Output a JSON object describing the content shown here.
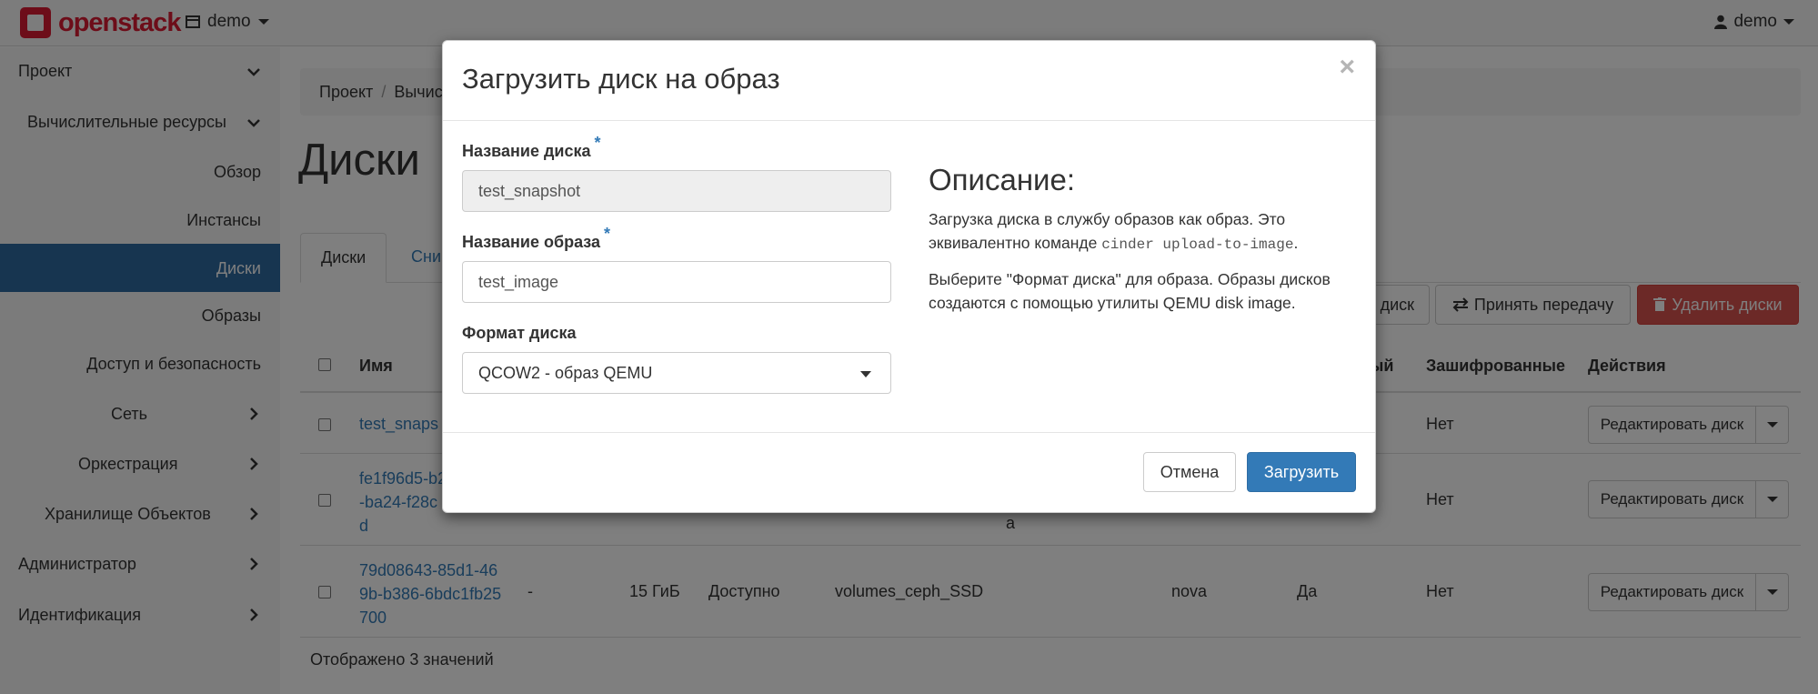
{
  "navbar": {
    "logo_text": "openstack",
    "project_label": "demo",
    "user_label": "demo"
  },
  "sidebar": {
    "items": [
      {
        "label": "Проект"
      },
      {
        "label": "Вычислительные ресурсы"
      },
      {
        "label": "Обзор"
      },
      {
        "label": "Инстансы"
      },
      {
        "label": "Диски"
      },
      {
        "label": "Образы"
      },
      {
        "label": "Доступ и безопасность"
      },
      {
        "label": "Сеть"
      },
      {
        "label": "Оркестрация"
      },
      {
        "label": "Хранилище Объектов"
      },
      {
        "label": "Администратор"
      },
      {
        "label": "Идентификация"
      }
    ]
  },
  "main": {
    "breadcrumb": [
      "Проект",
      "/",
      "Вычис"
    ],
    "title": "Диски",
    "tabs": [
      "Диски",
      "Сни"
    ],
    "actions": {
      "create_partial": "диск",
      "accept_transfer": "Принять передачу",
      "delete": "Удалить диски"
    },
    "table": {
      "headers": {
        "name": "Имя",
        "bootable_partial": "ый",
        "encrypted": "Зашифрованные",
        "actions": "Действия"
      },
      "rows": [
        {
          "name": "test_snaps",
          "encrypted": "Нет",
          "action": "Редактировать диск"
        },
        {
          "name_lines": [
            "fe1f96d5-b2",
            "-ba24-f28c",
            "d"
          ],
          "extra": "a",
          "encrypted": "Нет",
          "action": "Редактировать диск"
        },
        {
          "name_lines": [
            "79d08643-85d1-46",
            "9b-b386-6bdc1fb25",
            "700"
          ],
          "description": "-",
          "size": "15 ГиБ",
          "status": "Доступно",
          "type": "volumes_ceph_SSD",
          "zone": "nova",
          "bootable": "Да",
          "encrypted": "Нет",
          "action": "Редактировать диск"
        }
      ]
    },
    "footer": "Отображено 3 значений"
  },
  "modal": {
    "title": "Загрузить диск на образ",
    "close": "×",
    "fields": {
      "volume_name": {
        "label": "Название диска",
        "required": "*",
        "value": "test_snapshot"
      },
      "image_name": {
        "label": "Название образа",
        "required": "*",
        "value": "test_image"
      },
      "disk_format": {
        "label": "Формат диска",
        "value": "QCOW2 - образ QEMU"
      }
    },
    "description": {
      "title": "Описание:",
      "p1_before": "Загрузка диска в службу образов как образ. Это эквивалентно команде ",
      "p1_code": "cinder upload-to-image",
      "p1_after": ".",
      "p2": "Выберите \"Формат диска\" для образа. Образы дисков создаются с помощью утилиты QEMU disk image."
    },
    "buttons": {
      "cancel": "Отмена",
      "submit": "Загрузить"
    }
  }
}
